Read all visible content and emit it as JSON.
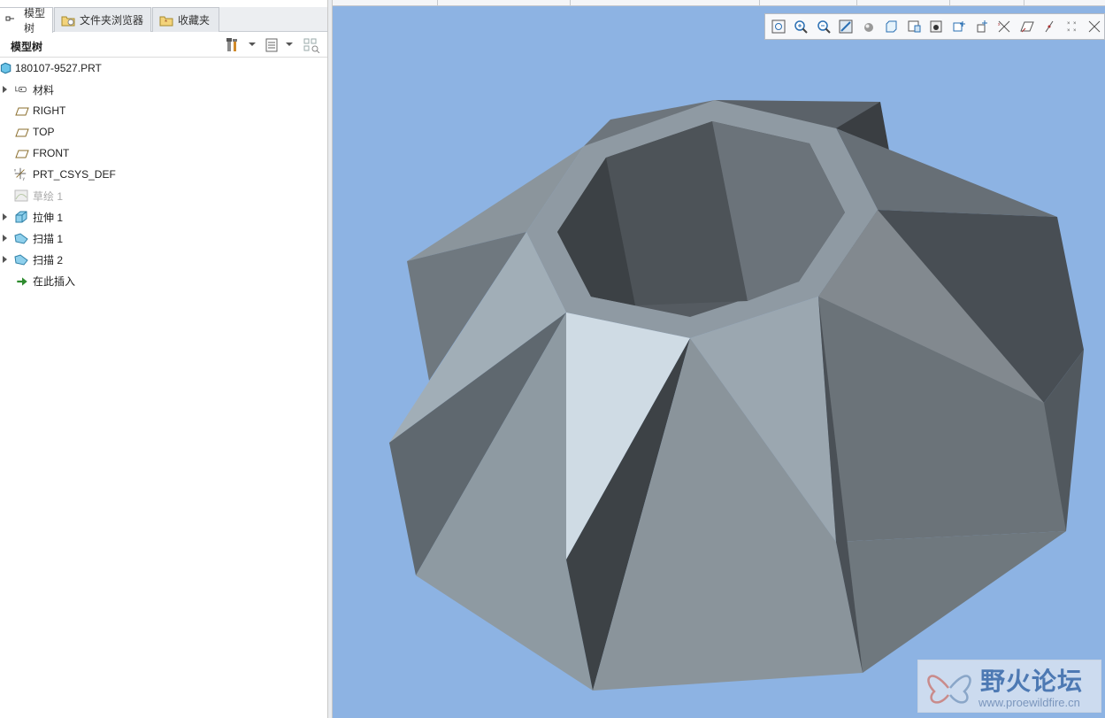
{
  "tabs": [
    {
      "label": "模型树",
      "icon": "tree-icon"
    },
    {
      "label": "文件夹浏览器",
      "icon": "folder-browser-icon"
    },
    {
      "label": "收藏夹",
      "icon": "favorites-icon"
    }
  ],
  "panel": {
    "title": "模型树",
    "tools": [
      "settings-tools-icon",
      "show-options-icon",
      "filter-icon"
    ]
  },
  "tree": {
    "root": "180107-9527.PRT",
    "items": [
      {
        "label": "材料",
        "icon": "material-icon",
        "expandable": true,
        "disabled": false
      },
      {
        "label": "RIGHT",
        "icon": "datum-plane-icon",
        "expandable": false,
        "disabled": false
      },
      {
        "label": "TOP",
        "icon": "datum-plane-icon",
        "expandable": false,
        "disabled": false
      },
      {
        "label": "FRONT",
        "icon": "datum-plane-icon",
        "expandable": false,
        "disabled": false
      },
      {
        "label": "PRT_CSYS_DEF",
        "icon": "coordinate-system-icon",
        "expandable": false,
        "disabled": false
      },
      {
        "label": "草绘 1",
        "icon": "sketch-icon",
        "expandable": false,
        "disabled": true
      },
      {
        "label": "拉伸 1",
        "icon": "extrude-icon",
        "expandable": true,
        "disabled": false
      },
      {
        "label": "扫描 1",
        "icon": "sweep-icon",
        "expandable": true,
        "disabled": false
      },
      {
        "label": "扫描 2",
        "icon": "sweep-icon",
        "expandable": true,
        "disabled": false
      },
      {
        "label": "在此插入",
        "icon": "insert-here-arrow-icon",
        "expandable": false,
        "disabled": false
      }
    ]
  },
  "view_toolbar": [
    "refit-icon",
    "zoom-in-icon",
    "zoom-out-icon",
    "repaint-icon",
    "display-style-icon",
    "saved-views-icon",
    "view-manager-icon",
    "perspective-icon",
    "datum-display-icon",
    "plane-display-icon",
    "axis-display-icon",
    "point-display-icon",
    "csys-display-icon",
    "annotation-display-icon",
    "spin-center-icon"
  ],
  "watermark": {
    "title": "野火论坛",
    "url": "www.proewildfire.cn"
  },
  "colors": {
    "viewport_bg": "#8db3e3",
    "model_light": "#cfdbe4",
    "model_mid": "#8e9aa2",
    "model_dark": "#3d4246"
  }
}
